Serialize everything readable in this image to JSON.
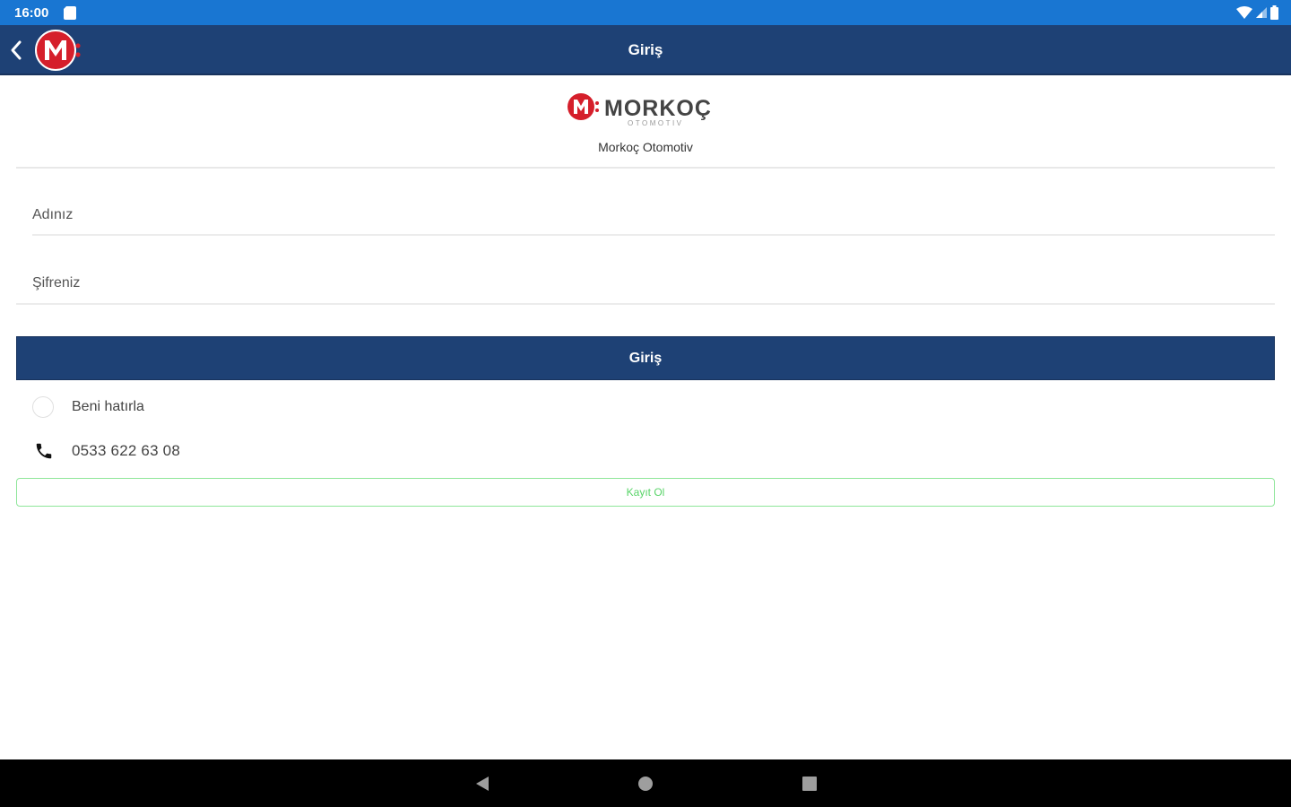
{
  "status_bar": {
    "time": "16:00"
  },
  "app_bar": {
    "title": "Giriş"
  },
  "brand": {
    "name": "Morkoç Otomotiv",
    "logo_text": "MORKOÇ",
    "logo_subtext": "OTOMOTIV"
  },
  "form": {
    "username_placeholder": "Adınız",
    "password_placeholder": "Şifreniz",
    "login_label": "Giriş",
    "remember_label": "Beni hatırla",
    "phone": "0533 622 63 08",
    "register_label": "Kayıt Ol"
  },
  "colors": {
    "status_bar": "#1976d2",
    "app_bar": "#1e4175",
    "brand_red": "#d51f2b",
    "register_green": "#58d468"
  }
}
